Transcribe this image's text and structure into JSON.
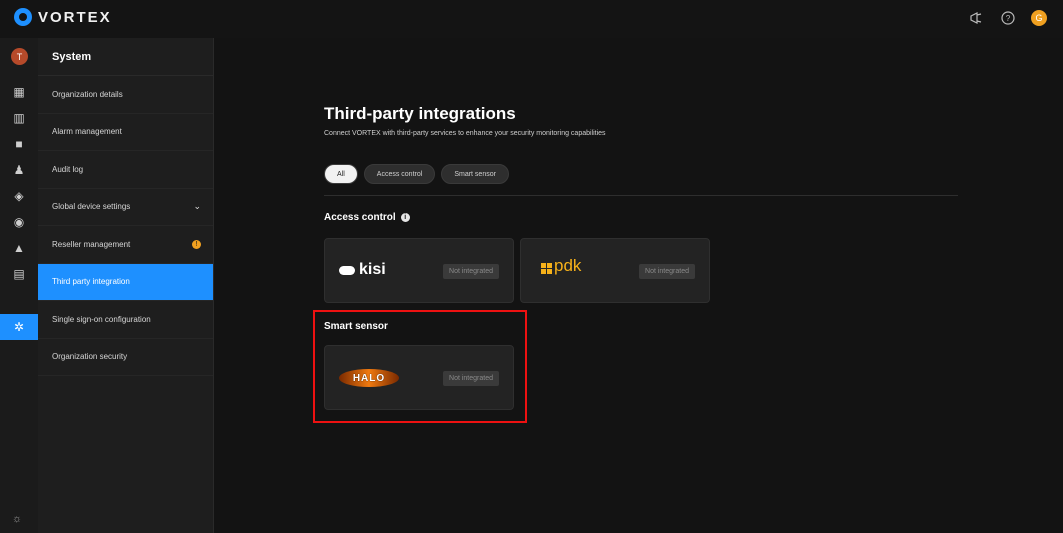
{
  "app": {
    "name": "VORTEX"
  },
  "topbar": {
    "icons": [
      "announcement-icon",
      "help-icon"
    ],
    "user_initial": "G"
  },
  "rail": {
    "avatar_initial": "T",
    "items": [
      "dashboard-icon",
      "grid-icon",
      "camera-icon",
      "person-icon",
      "device-icon",
      "location-icon",
      "alert-icon",
      "archive-icon",
      "settings-icon"
    ],
    "active_item": "settings-icon",
    "theme_icon": "sun-icon"
  },
  "sidenav": {
    "title": "System",
    "items": [
      {
        "label": "Organization details"
      },
      {
        "label": "Alarm management"
      },
      {
        "label": "Audit log"
      },
      {
        "label": "Global device settings",
        "has_chevron": true
      },
      {
        "label": "Reseller management",
        "badge": "!"
      },
      {
        "label": "Third party integration",
        "active": true
      },
      {
        "label": "Single sign-on configuration"
      },
      {
        "label": "Organization security"
      }
    ]
  },
  "main": {
    "title": "Third-party integrations",
    "subtitle": "Connect VORTEX with third-party services to enhance your security monitoring capabilities",
    "filters": [
      "All",
      "Access control",
      "Smart sensor"
    ],
    "active_filter": "All",
    "sections": [
      {
        "title": "Access control",
        "cards": [
          {
            "logo": "kisi",
            "status": "Not integrated"
          },
          {
            "logo": "pdk",
            "status": "Not integrated"
          }
        ]
      },
      {
        "title": "Smart sensor",
        "cards": [
          {
            "logo": "HALO",
            "status": "Not integrated"
          }
        ]
      }
    ]
  },
  "colors": {
    "accent": "#1e90ff",
    "highlight_box": "#ee1111",
    "pdk_brand": "#f6b11a",
    "badge": "#f0a020"
  }
}
